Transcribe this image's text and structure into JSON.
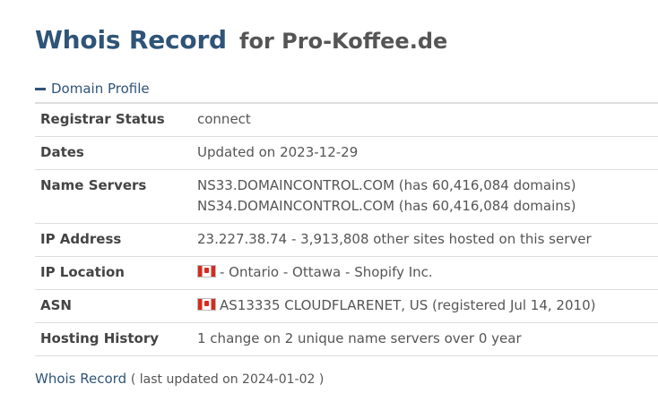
{
  "header": {
    "title_main": "Whois Record",
    "title_sub": "for Pro-Koffee.de"
  },
  "section": {
    "label": "Domain Profile",
    "toggle_icon": "minus-icon"
  },
  "rows": {
    "registrar_status": {
      "label": "Registrar Status",
      "value": "connect"
    },
    "dates": {
      "label": "Dates",
      "value": "Updated on 2023-12-29"
    },
    "name_servers": {
      "label": "Name Servers",
      "values": [
        "NS33.DOMAINCONTROL.COM (has 60,416,084 domains)",
        "NS34.DOMAINCONTROL.COM (has 60,416,084 domains)"
      ]
    },
    "ip_address": {
      "label": "IP Address",
      "value": "23.227.38.74 - 3,913,808 other sites hosted on this server"
    },
    "ip_location": {
      "label": "IP Location",
      "value": "- Ontario - Ottawa - Shopify Inc.",
      "flag_icon": "canada-flag-icon"
    },
    "asn": {
      "label": "ASN",
      "value": "AS13335 CLOUDFLARENET, US (registered Jul 14, 2010)",
      "flag_icon": "canada-flag-icon"
    },
    "hosting_history": {
      "label": "Hosting History",
      "value": "1 change on 2 unique name servers over 0 year"
    }
  },
  "footer": {
    "link": "Whois Record",
    "note": "( last updated on 2024-01-02 )"
  },
  "colors": {
    "heading": "#2f5478",
    "text": "#555555",
    "label": "#444444",
    "border": "#dddddd",
    "flag_red": "#d52b1e"
  }
}
